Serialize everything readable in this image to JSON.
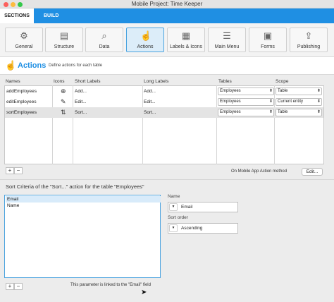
{
  "window": {
    "title": "Mobile Project: Time Keeper"
  },
  "tabs": {
    "sections": "SECTIONS",
    "build": "BUILD"
  },
  "toolbar": [
    {
      "label": "General",
      "icon": "gear-icon",
      "glyph": "⚙"
    },
    {
      "label": "Structure",
      "icon": "structure-icon",
      "glyph": "▤"
    },
    {
      "label": "Data",
      "icon": "data-icon",
      "glyph": "⌕"
    },
    {
      "label": "Actions",
      "icon": "pointer-hand-icon",
      "glyph": "☝",
      "active": true
    },
    {
      "label": "Labels & Icons",
      "icon": "labels-icons-icon",
      "glyph": "▦"
    },
    {
      "label": "Main Menu",
      "icon": "main-menu-icon",
      "glyph": "☰"
    },
    {
      "label": "Forms",
      "icon": "forms-icon",
      "glyph": "▣"
    },
    {
      "label": "Publishing",
      "icon": "publishing-icon",
      "glyph": "⇪"
    }
  ],
  "header": {
    "title": "Actions",
    "subtitle": "Define actions for each table",
    "icon": "pointer-hand-icon"
  },
  "table": {
    "columns": [
      "Names",
      "Icons",
      "Short Labels",
      "Long Labels",
      "Tables",
      "Scope"
    ],
    "rows": [
      {
        "name": "addEmployees",
        "icon": "add-circle-icon",
        "glyph": "⊕",
        "short": "Add...",
        "long": "Add...",
        "table": "Employees",
        "scope": "Table"
      },
      {
        "name": "editEmployees",
        "icon": "pencil-icon",
        "glyph": "✎",
        "short": "Edit...",
        "long": "Edit...",
        "table": "Employees",
        "scope": "Current entity"
      },
      {
        "name": "sortEmployees",
        "icon": "sort-arrows-icon",
        "glyph": "⇅",
        "short": "Sort...",
        "long": "Sort...",
        "table": "Employees",
        "scope": "Table",
        "selected": true
      }
    ],
    "add_label": "+",
    "remove_label": "−",
    "method_label": "On Mobile App Action method",
    "edit_label": "Edit..."
  },
  "sort": {
    "title": "Sort Criteria of the \"Sort...\" action for the table \"Employees\"",
    "fields": [
      "Email",
      "Name"
    ],
    "name_label": "Name",
    "name_value": "Email",
    "order_label": "Sort order",
    "order_value": "Ascending",
    "add_label": "+",
    "remove_label": "−",
    "linked_note": "This parameter is linked to the \"Email\" field"
  },
  "colors": {
    "accent": "#1f8fe3",
    "selection": "#d8ebfa"
  }
}
